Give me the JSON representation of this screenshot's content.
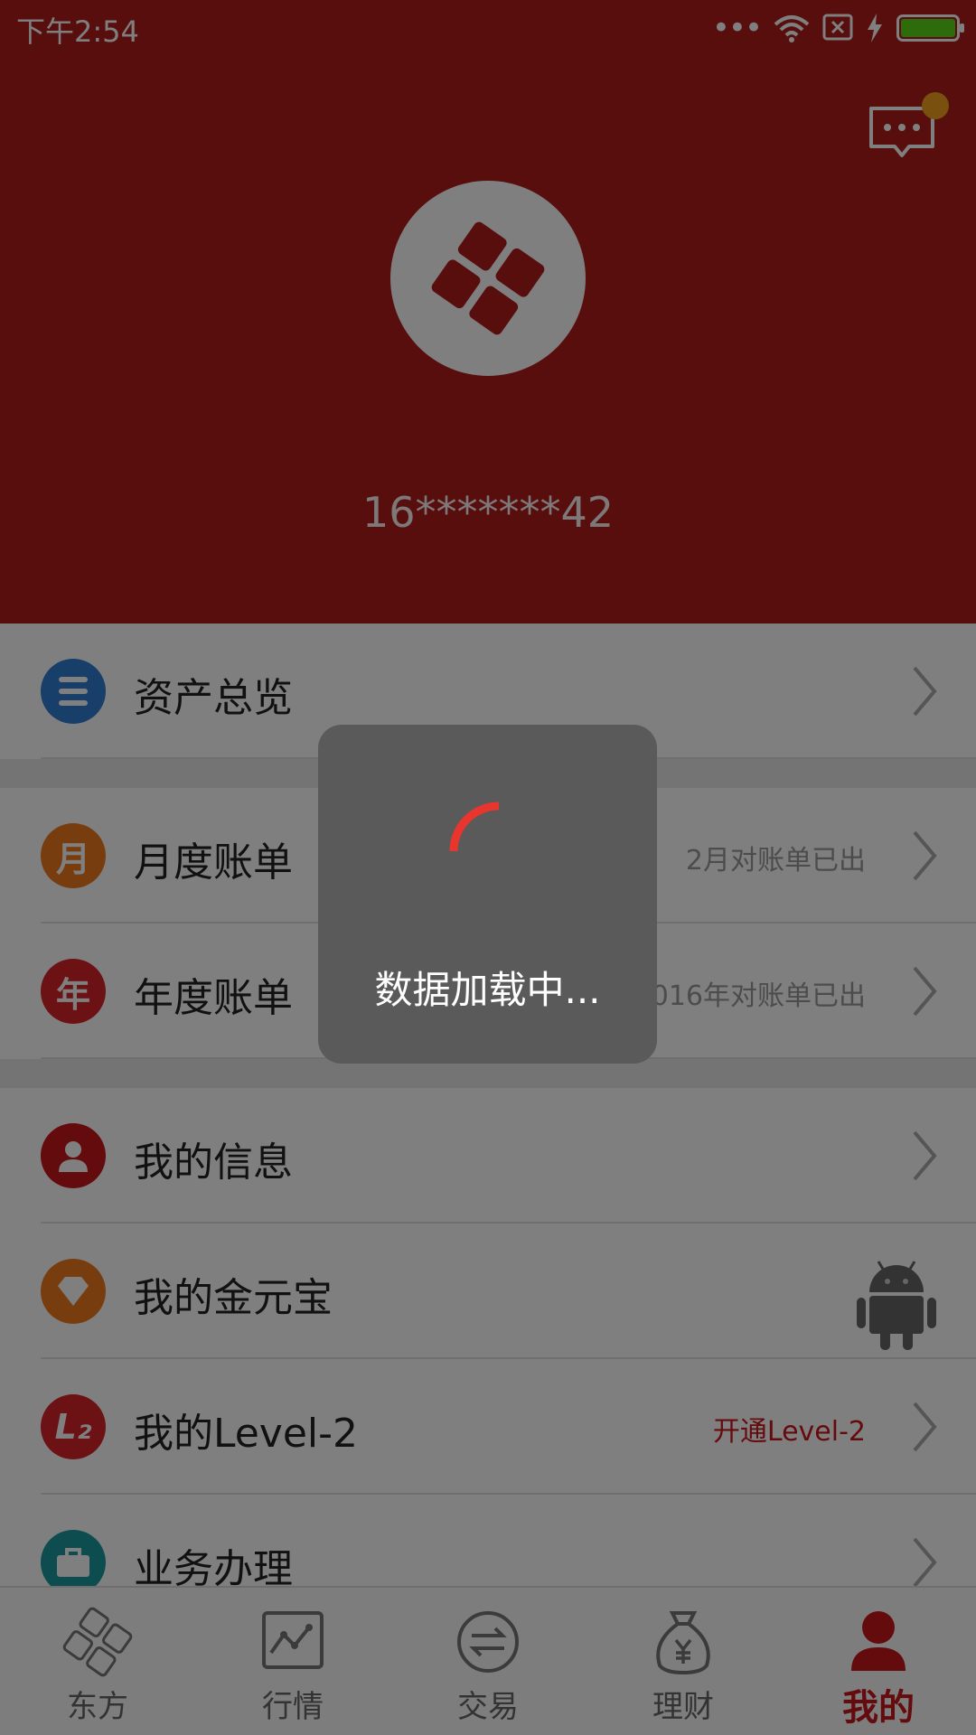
{
  "status_bar": {
    "time": "下午2:54",
    "dots": "•••"
  },
  "header": {
    "account": "16*******42"
  },
  "menu": [
    {
      "label": "资产总览",
      "hint": "",
      "icon": "list-icon",
      "icon_text": "",
      "color": "#2f7fd3"
    },
    {
      "label": "月度账单",
      "hint": "2月对账单已出",
      "icon": "month-icon",
      "icon_text": "月",
      "color": "#f07a1c"
    },
    {
      "label": "年度账单",
      "hint": "2016年对账单已出",
      "icon": "year-icon",
      "icon_text": "年",
      "color": "#d9252b"
    },
    {
      "label": "我的信息",
      "hint": "",
      "icon": "person-icon",
      "icon_text": "",
      "color": "#c9161d"
    },
    {
      "label": "我的金元宝",
      "hint": "",
      "icon": "diamond-icon",
      "icon_text": "",
      "color": "#f07a1c"
    },
    {
      "label": "我的Level-2",
      "hint": "开通Level-2",
      "icon": "l2-icon",
      "icon_text": "L₂",
      "color": "#d9252b"
    },
    {
      "label": "业务办理",
      "hint": "",
      "icon": "briefcase-icon",
      "icon_text": "",
      "color": "#1a9aa0"
    }
  ],
  "tabs": [
    {
      "label": "东方",
      "icon": "dongfang-logo-icon"
    },
    {
      "label": "行情",
      "icon": "chart-icon"
    },
    {
      "label": "交易",
      "icon": "exchange-icon"
    },
    {
      "label": "理财",
      "icon": "money-bag-icon"
    },
    {
      "label": "我的",
      "icon": "person-icon",
      "active": true
    }
  ],
  "loading": {
    "text": "数据加载中..."
  },
  "colors": {
    "brand": "#b31c1c",
    "accent": "#c9161d",
    "spinner": "#e8362f"
  }
}
